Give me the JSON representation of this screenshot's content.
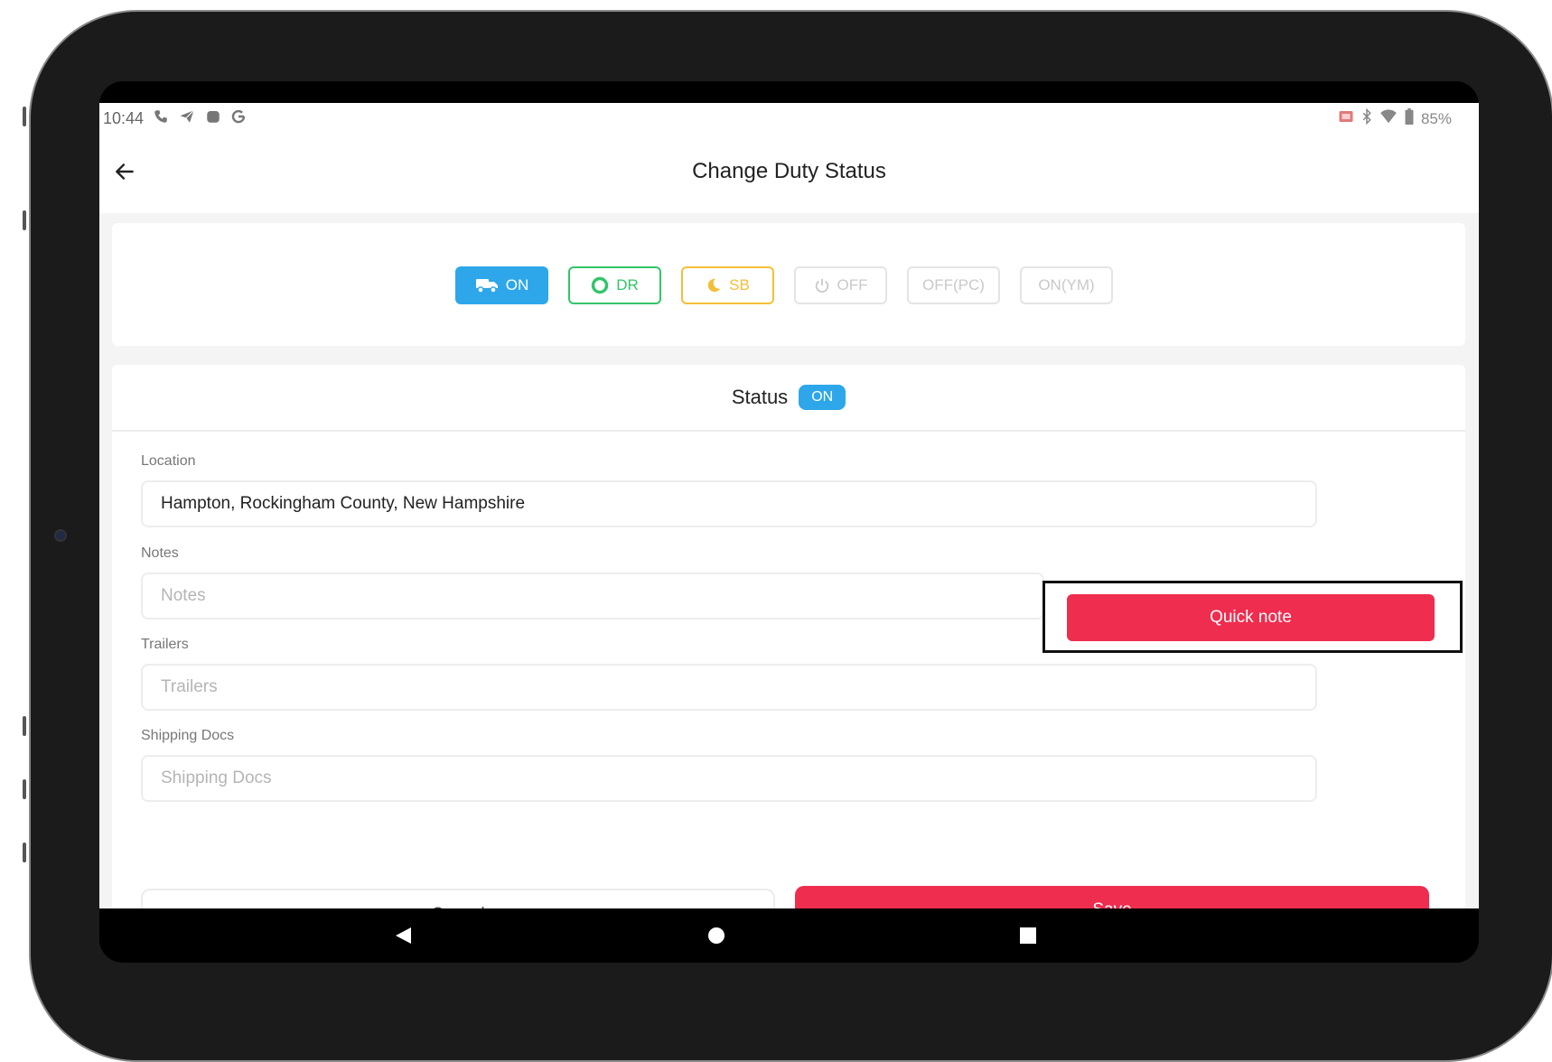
{
  "statusbar": {
    "time": "10:44",
    "icons_left": [
      "phone-icon",
      "send-icon",
      "app-icon",
      "google-icon"
    ],
    "icons_right": [
      "cast-icon",
      "bluetooth-icon",
      "wifi-icon",
      "battery-icon"
    ],
    "battery": "85%"
  },
  "appbar": {
    "title": "Change Duty Status"
  },
  "duty_chips": [
    {
      "label": "ON",
      "icon": "truck-icon",
      "state": "selected"
    },
    {
      "label": "DR",
      "icon": "ring-icon",
      "state": "enabled"
    },
    {
      "label": "SB",
      "icon": "moon-icon",
      "state": "enabled"
    },
    {
      "label": "OFF",
      "icon": "power-icon",
      "state": "disabled"
    },
    {
      "label": "OFF(PC)",
      "state": "disabled"
    },
    {
      "label": "ON(YM)",
      "state": "disabled"
    }
  ],
  "status": {
    "label": "Status",
    "value": "ON"
  },
  "form": {
    "location_label": "Location",
    "location_value": "Hampton, Rockingham County, New Hampshire",
    "notes_label": "Notes",
    "notes_placeholder": "Notes",
    "quick_note_label": "Quick note",
    "trailers_label": "Trailers",
    "trailers_placeholder": "Trailers",
    "shipping_label": "Shipping Docs",
    "shipping_placeholder": "Shipping Docs"
  },
  "actions": {
    "cancel": "Cancel",
    "save": "Save"
  },
  "colors": {
    "primary_blue": "#2ea7ea",
    "driving_green": "#33c46a",
    "sleeper_yellow": "#f3bf3a",
    "danger_red": "#ef2d4e"
  }
}
